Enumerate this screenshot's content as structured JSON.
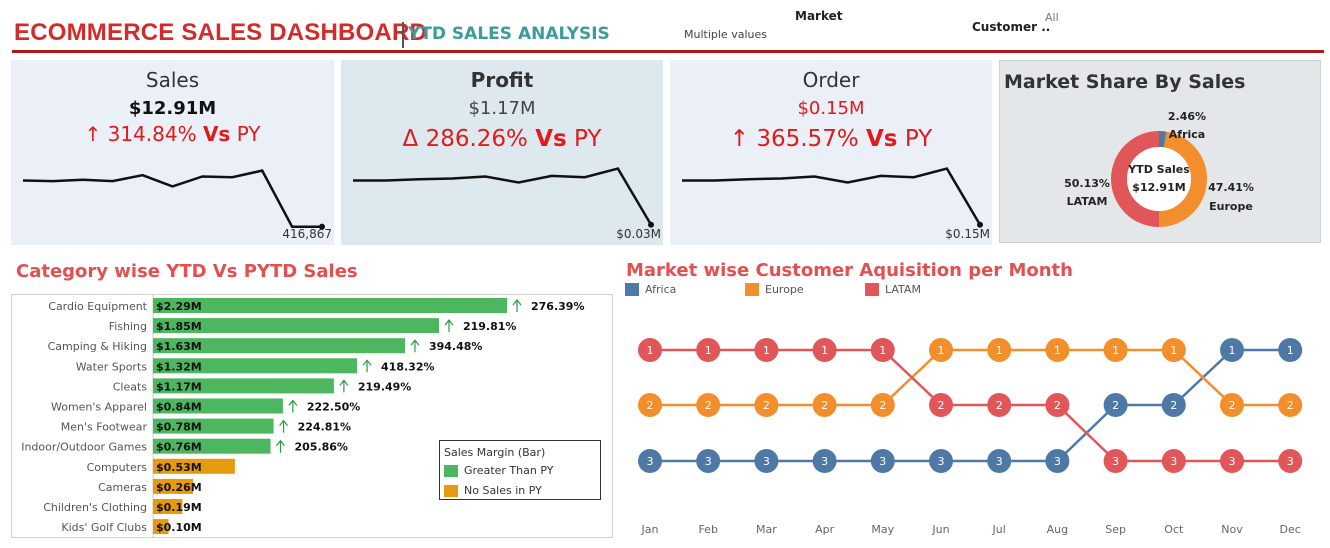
{
  "header": {
    "title": "ECOMMERCE SALES DASHBOARD",
    "subtitle": "YTD SALES ANALYSIS",
    "filters": {
      "market_label": "Market",
      "market_value": "Multiple values",
      "customer_label": "Customer ..",
      "customer_value": "All"
    }
  },
  "kpis": [
    {
      "title": "Sales",
      "value": "$12.91M",
      "change_symbol": "↑",
      "change_pct": "314.84%",
      "change_vs": "Vs",
      "change_py": "PY",
      "end_label": "416,867",
      "trend": [
        0.28,
        0.29,
        0.27,
        0.29,
        0.2,
        0.37,
        0.22,
        0.23,
        0.13,
        0.98,
        0.98
      ]
    },
    {
      "title": "Profit",
      "value": "$1.17M",
      "change_symbol": "Δ",
      "change_pct": "286.26%",
      "change_vs": "Vs",
      "change_py": "PY",
      "end_label": "$0.03M",
      "trend": [
        0.28,
        0.28,
        0.26,
        0.25,
        0.22,
        0.31,
        0.21,
        0.23,
        0.1,
        0.95
      ]
    },
    {
      "title": "Order",
      "value": "$0.15M",
      "change_symbol": "↑",
      "change_pct": "365.57%",
      "change_vs": "Vs",
      "change_py": "PY",
      "end_label": "$0.15M",
      "trend": [
        0.28,
        0.28,
        0.26,
        0.25,
        0.22,
        0.31,
        0.21,
        0.23,
        0.1,
        0.95
      ]
    }
  ],
  "market_share": {
    "title": "Market Share By Sales",
    "center_label": "YTD Sales",
    "center_value": "$12.91M",
    "slices": [
      {
        "name": "Africa",
        "pct": 2.46,
        "label": "2.46%",
        "color": "#4e79a7"
      },
      {
        "name": "Europe",
        "pct": 47.41,
        "label": "47.41%",
        "color": "#f28e2b"
      },
      {
        "name": "LATAM",
        "pct": 50.13,
        "label": "50.13%",
        "color": "#e15759"
      }
    ]
  },
  "chart_data": [
    {
      "type": "bar",
      "title": "Category wise YTD Vs PYTD Sales",
      "categories": [
        "Cardio Equipment",
        "Fishing",
        "Camping & Hiking",
        "Water Sports",
        "Cleats",
        "Women's Apparel",
        "Men's Footwear",
        "Indoor/Outdoor Games",
        "Computers",
        "Cameras",
        "Children's Clothing",
        "Kids' Golf Clubs"
      ],
      "values": [
        2.29,
        1.85,
        1.63,
        1.32,
        1.17,
        0.84,
        0.78,
        0.76,
        0.53,
        0.26,
        0.19,
        0.1
      ],
      "value_labels": [
        "$2.29M",
        "$1.85M",
        "$1.63M",
        "$1.32M",
        "$1.17M",
        "$0.84M",
        "$0.78M",
        "$0.76M",
        "$0.53M",
        "$0.26M",
        "$0.19M",
        "$0.10M"
      ],
      "growth_labels": [
        "276.39%",
        "219.81%",
        "394.48%",
        "418.32%",
        "219.49%",
        "222.50%",
        "224.81%",
        "205.86%",
        "",
        "",
        "",
        ""
      ],
      "margin_class": [
        "greater",
        "greater",
        "greater",
        "greater",
        "greater",
        "greater",
        "greater",
        "greater",
        "nosales",
        "nosales",
        "nosales",
        "nosales"
      ],
      "legend": {
        "title": "Sales Margin (Bar)",
        "items": [
          {
            "key": "greater",
            "label": "Greater Than PY",
            "color": "#4cb75f"
          },
          {
            "key": "nosales",
            "label": "No Sales in PY",
            "color": "#e69a0e"
          }
        ]
      },
      "arrow_color": "#2a9d3c"
    },
    {
      "type": "line",
      "title": "Market wise Customer Aquisition per Month",
      "x": [
        "Jan",
        "Feb",
        "Mar",
        "Apr",
        "May",
        "Jun",
        "Jul",
        "Aug",
        "Sep",
        "Oct",
        "Nov",
        "Dec"
      ],
      "ylim": [
        1,
        3
      ],
      "series": [
        {
          "name": "Africa",
          "color": "#4e79a7",
          "values": [
            3,
            3,
            3,
            3,
            3,
            3,
            3,
            3,
            2,
            2,
            1,
            1
          ]
        },
        {
          "name": "Europe",
          "color": "#f28e2b",
          "values": [
            2,
            2,
            2,
            2,
            2,
            1,
            1,
            1,
            1,
            1,
            2,
            2
          ]
        },
        {
          "name": "LATAM",
          "color": "#e15759",
          "values": [
            1,
            1,
            1,
            1,
            1,
            2,
            2,
            2,
            3,
            3,
            3,
            3
          ]
        }
      ]
    }
  ]
}
